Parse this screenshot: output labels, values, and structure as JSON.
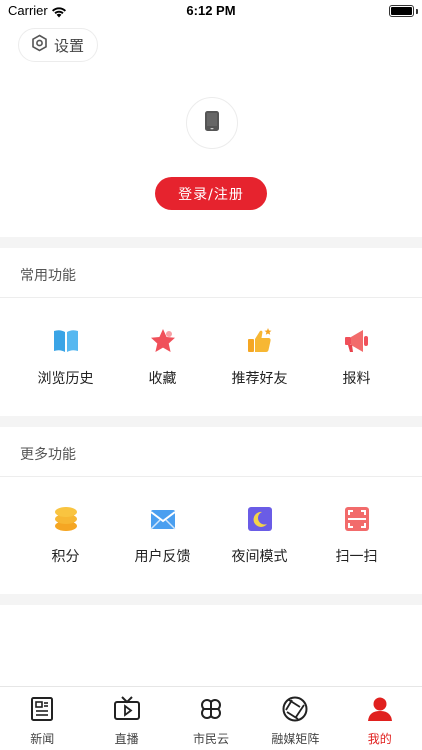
{
  "status_bar": {
    "carrier": "Carrier",
    "time": "6:12 PM"
  },
  "header": {
    "settings_label": "设置"
  },
  "profile": {
    "login_label": "登录/注册"
  },
  "common_section": {
    "title": "常用功能",
    "items": [
      {
        "label": "浏览历史",
        "icon": "book-icon"
      },
      {
        "label": "收藏",
        "icon": "star-icon"
      },
      {
        "label": "推荐好友",
        "icon": "thumbs-up-icon"
      },
      {
        "label": "报料",
        "icon": "megaphone-icon"
      }
    ]
  },
  "more_section": {
    "title": "更多功能",
    "items": [
      {
        "label": "积分",
        "icon": "coins-icon"
      },
      {
        "label": "用户反馈",
        "icon": "mail-icon"
      },
      {
        "label": "夜间模式",
        "icon": "moon-icon"
      },
      {
        "label": "扫一扫",
        "icon": "scan-icon"
      }
    ]
  },
  "tabbar": {
    "items": [
      {
        "label": "新闻",
        "icon": "newspaper-icon",
        "active": false
      },
      {
        "label": "直播",
        "icon": "tv-icon",
        "active": false
      },
      {
        "label": "市民云",
        "icon": "clover-icon",
        "active": false
      },
      {
        "label": "融媒矩阵",
        "icon": "aperture-icon",
        "active": false
      },
      {
        "label": "我的",
        "icon": "person-icon",
        "active": true
      }
    ]
  },
  "colors": {
    "accent": "#e6232e",
    "active_tab": "#e0201e"
  }
}
